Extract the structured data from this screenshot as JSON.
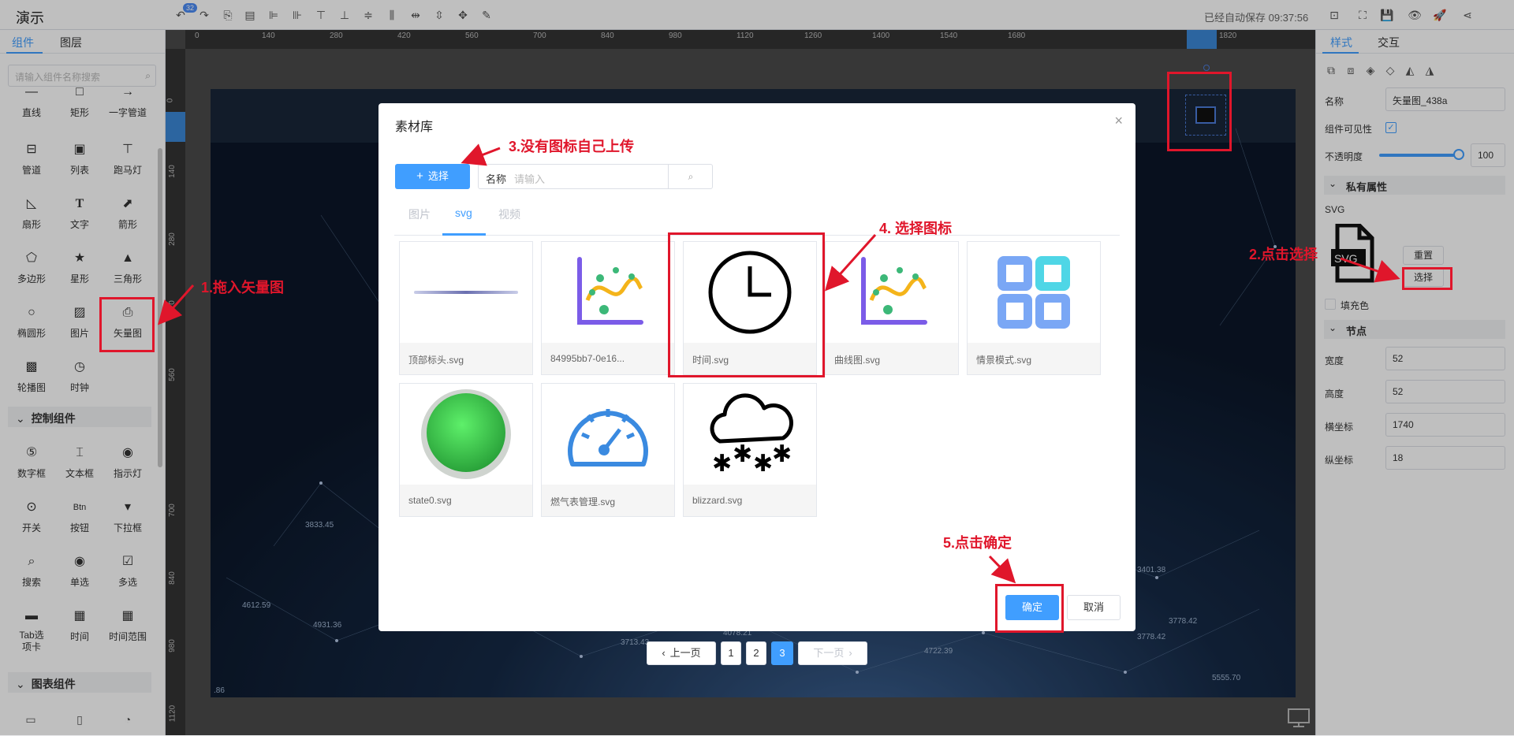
{
  "app_title": "演示",
  "undo_count": "32",
  "autosave": "已经自动保存 09:37:56",
  "left_tabs": [
    "组件",
    "图层"
  ],
  "left_search_placeholder": "请输入组件名称搜索",
  "components": [
    "直线",
    "矩形",
    "一字管道",
    "管道",
    "列表",
    "跑马灯",
    "扇形",
    "文字",
    "箭形",
    "多边形",
    "星形",
    "三角形",
    "椭圆形",
    "图片",
    "矢量图",
    "轮播图",
    "时钟"
  ],
  "section_control": "控制组件",
  "control_components": [
    "数字框",
    "文本框",
    "指示灯",
    "开关",
    "按钮",
    "下拉框",
    "搜索",
    "单选",
    "多选",
    "Tab选项卡",
    "时间",
    "时间范围"
  ],
  "section_chart": "图表组件",
  "ruler_h": [
    "0",
    "140",
    "280",
    "420",
    "560",
    "700",
    "840",
    "980",
    "1120",
    "1260",
    "1400",
    "1540",
    "1680",
    "1820"
  ],
  "ruler_v": [
    "0",
    "140",
    "280",
    "420",
    "560",
    "700",
    "840",
    "980",
    "1120"
  ],
  "right_tabs": [
    "样式",
    "交互"
  ],
  "props": {
    "name_label": "名称",
    "name_value": "矢量图_438a",
    "visible_label": "组件可见性",
    "opacity_label": "不透明度",
    "opacity_value": "100",
    "private_section": "私有属性",
    "svg_label": "SVG",
    "reset_label": "重置",
    "select_label": "选择",
    "fill_label": "填充色",
    "node_section": "节点",
    "width_label": "宽度",
    "width_value": "52",
    "height_label": "高度",
    "height_value": "52",
    "x_label": "横坐标",
    "x_value": "1740",
    "y_label": "纵坐标",
    "y_value": "18"
  },
  "modal": {
    "title": "素材库",
    "upload_label": "选择",
    "name_label": "名称",
    "name_placeholder": "请输入",
    "tabs": [
      "图片",
      "svg",
      "视频"
    ],
    "items": [
      {
        "name": "顶部标头.svg",
        "icon": "header-bar-icon"
      },
      {
        "name": "84995bb7-0e16...",
        "icon": "chart-curve-icon"
      },
      {
        "name": "时间.svg",
        "icon": "clock-icon"
      },
      {
        "name": "曲线图.svg",
        "icon": "chart-curve-icon"
      },
      {
        "name": "情景模式.svg",
        "icon": "grid-squares-icon"
      },
      {
        "name": "state0.svg",
        "icon": "green-ball-icon"
      },
      {
        "name": "燃气表管理.svg",
        "icon": "gauge-icon"
      },
      {
        "name": "blizzard.svg",
        "icon": "snow-cloud-icon"
      }
    ],
    "pagination": {
      "prev": "上一页",
      "pages": [
        "1",
        "2",
        "3"
      ],
      "current": "3",
      "next": "下一页"
    },
    "ok_label": "确定",
    "cancel_label": "取消"
  },
  "annotations": {
    "step1": "1.拖入矢量图",
    "step2": "2.点击选择",
    "step3": "3.没有图标自己上传",
    "step4": "4. 选择图标",
    "step5": "5.点击确定"
  },
  "canvas_numbers": [
    "3833.45",
    "4612.59",
    "4931.36",
    "3713.43",
    "4078.21",
    "4722.39",
    "3778.42",
    "3778.42",
    "3401.38",
    "5555.70",
    ".86"
  ],
  "colors": {
    "accent": "#409eff",
    "annotation": "#e0162b",
    "dark_bg": "#0b1628"
  }
}
